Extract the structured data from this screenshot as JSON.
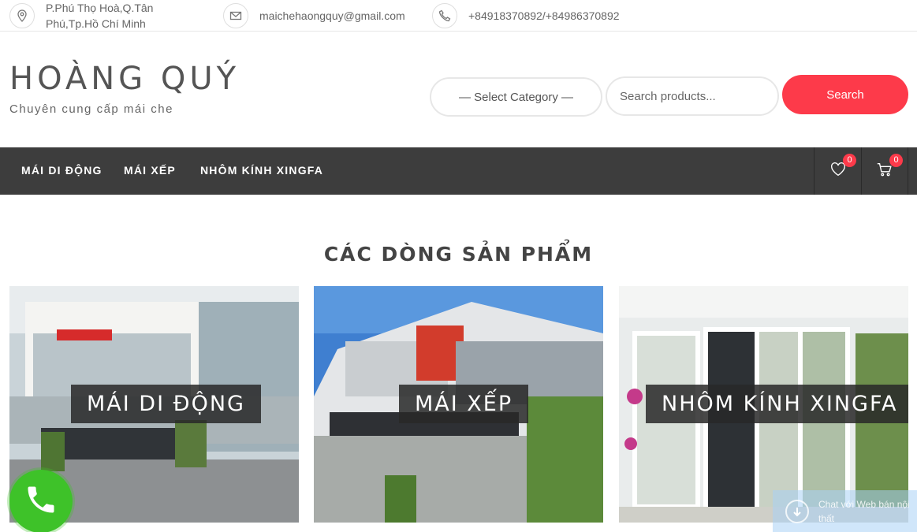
{
  "topbar": {
    "address": "P.Phú Thọ Hoà,Q.Tân Phú,Tp.Hồ Chí Minh",
    "email": "maichehaongquy@gmail.com",
    "phone": "+84918370892/+84986370892",
    "icons": [
      "map-pin-icon",
      "envelope-icon",
      "phone-icon"
    ]
  },
  "header": {
    "site_title": "HOÀNG QUÝ",
    "tagline": "Chuyên cung cấp mái che",
    "select_category": "— Select Category —",
    "search_placeholder": "Search products...",
    "search_button": "Search"
  },
  "nav": {
    "items": [
      {
        "label": "MÁI DI ĐỘNG"
      },
      {
        "label": "MÁI XẾP"
      },
      {
        "label": "NHÔM KÍNH XINGFA"
      }
    ],
    "wishlist_count": "0",
    "cart_count": "0"
  },
  "main": {
    "section_title": "CÁC DÒNG SẢN PHẨM",
    "categories": [
      {
        "label": "MÁI DI ĐỘNG"
      },
      {
        "label": "MÁI XẾP"
      },
      {
        "label": "NHÔM KÍNH XINGFA"
      }
    ]
  },
  "floating": {
    "chat_text": "Chat với Web bán nội thất"
  },
  "colors": {
    "accent": "#fd3a4a",
    "nav_bg": "#3d3d3d",
    "call_green": "#3ec229"
  }
}
